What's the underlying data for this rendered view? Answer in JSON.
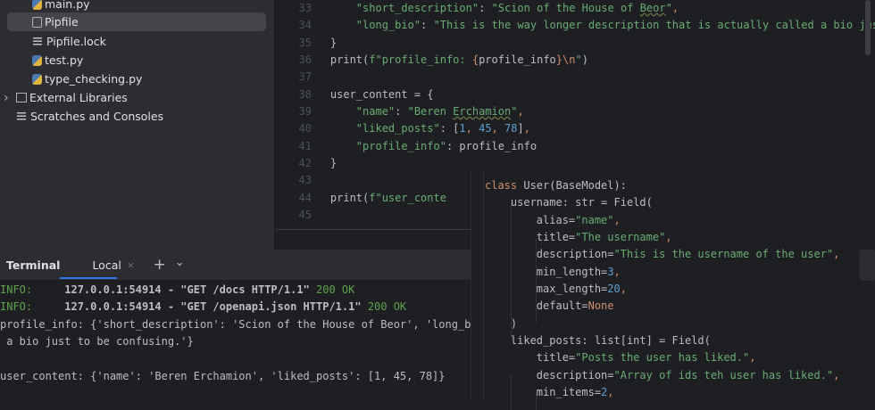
{
  "project_tree": {
    "items": [
      {
        "label": "main.py",
        "icon": "python-file-icon"
      },
      {
        "label": "Pipfile",
        "icon": "pipfile-icon",
        "selected": true
      },
      {
        "label": "Pipfile.lock",
        "icon": "text-file-icon"
      },
      {
        "label": "test.py",
        "icon": "python-file-icon"
      },
      {
        "label": "type_checking.py",
        "icon": "python-file-icon"
      },
      {
        "label": "External Libraries",
        "icon": "library-icon",
        "expandable": true
      },
      {
        "label": "Scratches and Consoles",
        "icon": "scratches-icon"
      }
    ]
  },
  "editor": {
    "line_numbers": [
      "33",
      "34",
      "35",
      "36",
      "37",
      "38",
      "39",
      "40",
      "41",
      "42",
      "43",
      "44",
      "45"
    ],
    "lines": [
      [
        [
          "        ",
          ""
        ],
        [
          "\"short_description\"",
          "str"
        ],
        [
          ": ",
          ""
        ],
        [
          "\"Scion of the House of ",
          "str"
        ],
        [
          "Beor",
          "str warn"
        ],
        [
          "\"",
          "str"
        ],
        [
          ",",
          "kw"
        ]
      ],
      [
        [
          "        ",
          ""
        ],
        [
          "\"long_bio\"",
          "str"
        ],
        [
          ": ",
          ""
        ],
        [
          "\"This is the way longer description that is actually called a bio just",
          "str"
        ]
      ],
      [
        [
          "    }",
          ""
        ]
      ],
      [
        [
          "    print(",
          ""
        ],
        [
          "f\"profile_info: ",
          "str"
        ],
        [
          "{",
          "kw"
        ],
        [
          "profile_info",
          ""
        ],
        [
          "}",
          "kw"
        ],
        [
          "\\n",
          "kw"
        ],
        [
          "\"",
          "str"
        ],
        [
          ")",
          ""
        ]
      ],
      [
        [
          "",
          ""
        ]
      ],
      [
        [
          "    user_content = {",
          ""
        ]
      ],
      [
        [
          "        ",
          ""
        ],
        [
          "\"name\"",
          "str"
        ],
        [
          ": ",
          ""
        ],
        [
          "\"Beren ",
          "str"
        ],
        [
          "Erchamion",
          "str warn"
        ],
        [
          "\"",
          "str"
        ],
        [
          ",",
          "kw"
        ]
      ],
      [
        [
          "        ",
          ""
        ],
        [
          "\"liked_posts\"",
          "str"
        ],
        [
          ": [",
          ""
        ],
        [
          "1",
          "num2"
        ],
        [
          ", ",
          "kw"
        ],
        [
          "45",
          "num2"
        ],
        [
          ", ",
          "kw"
        ],
        [
          "78",
          "num2"
        ],
        [
          "]",
          ""
        ],
        [
          ",",
          "kw"
        ]
      ],
      [
        [
          "        ",
          ""
        ],
        [
          "\"profile_info\"",
          "str"
        ],
        [
          ": profile_info",
          ""
        ]
      ],
      [
        [
          "    }",
          ""
        ]
      ],
      [
        [
          "",
          ""
        ]
      ],
      [
        [
          "    print(",
          ""
        ],
        [
          "f\"user_conte",
          "str"
        ]
      ],
      [
        [
          "",
          ""
        ]
      ]
    ]
  },
  "popup": {
    "lines": [
      [
        [
          "class ",
          "kw"
        ],
        [
          "User(BaseModel):",
          ""
        ]
      ],
      [
        [
          "    username: str = Field(",
          ""
        ]
      ],
      [
        [
          "        alias=",
          ""
        ],
        [
          "\"name\"",
          "str"
        ],
        [
          ",",
          "kw"
        ]
      ],
      [
        [
          "        title=",
          ""
        ],
        [
          "\"The username\"",
          "str"
        ],
        [
          ",",
          "kw"
        ]
      ],
      [
        [
          "        description=",
          ""
        ],
        [
          "\"This is the username of the user\"",
          "str"
        ],
        [
          ",",
          "kw"
        ]
      ],
      [
        [
          "        min_length=",
          ""
        ],
        [
          "3",
          "num2"
        ],
        [
          ",",
          "kw"
        ]
      ],
      [
        [
          "        max_length=",
          ""
        ],
        [
          "20",
          "num2"
        ],
        [
          ",",
          "kw"
        ]
      ],
      [
        [
          "        default=",
          ""
        ],
        [
          "None",
          "kw"
        ]
      ],
      [
        [
          "    )",
          ""
        ]
      ],
      [
        [
          "    liked_posts: list[int] = Field(",
          ""
        ]
      ],
      [
        [
          "        title=",
          ""
        ],
        [
          "\"Posts the user has liked.\"",
          "str"
        ],
        [
          ",",
          "kw"
        ]
      ],
      [
        [
          "        description=",
          ""
        ],
        [
          "\"Array of ids teh user has liked.\"",
          "str"
        ],
        [
          ",",
          "kw"
        ]
      ],
      [
        [
          "        min_items=",
          ""
        ],
        [
          "2",
          "num2"
        ],
        [
          ",",
          "kw"
        ]
      ]
    ]
  },
  "terminal": {
    "title": "Terminal",
    "tab_label": "Local",
    "close_glyph": "×",
    "add_glyph": "+",
    "dropdown_glyph": "⌄",
    "output": [
      [
        [
          "INFO:",
          "info"
        ],
        [
          "     127.0.0.1:54914 - \"GET /docs HTTP/1.1\" ",
          "b"
        ],
        [
          "200 OK",
          "ok"
        ]
      ],
      [
        [
          "INFO:",
          "info"
        ],
        [
          "     127.0.0.1:54914 - \"GET /openapi.json HTTP/1.1\" ",
          "b"
        ],
        [
          "200 OK",
          "ok"
        ]
      ],
      [
        [
          "profile_info: {'short_description': 'Scion of the House of Beor', 'long_bio",
          ""
        ]
      ],
      [
        [
          " a bio just to be confusing.'}",
          ""
        ]
      ],
      [
        [
          "",
          ""
        ]
      ],
      [
        [
          "user_content: {'name': 'Beren Erchamion', 'liked_posts': [1, 45, 78]}",
          ""
        ]
      ]
    ]
  },
  "colors": {
    "accent": "#3574f0",
    "string": "#6aab73",
    "keyword": "#cf8e6d",
    "number": "#5f9fd0",
    "background": "#1e1f22",
    "panel": "#2b2d30"
  }
}
